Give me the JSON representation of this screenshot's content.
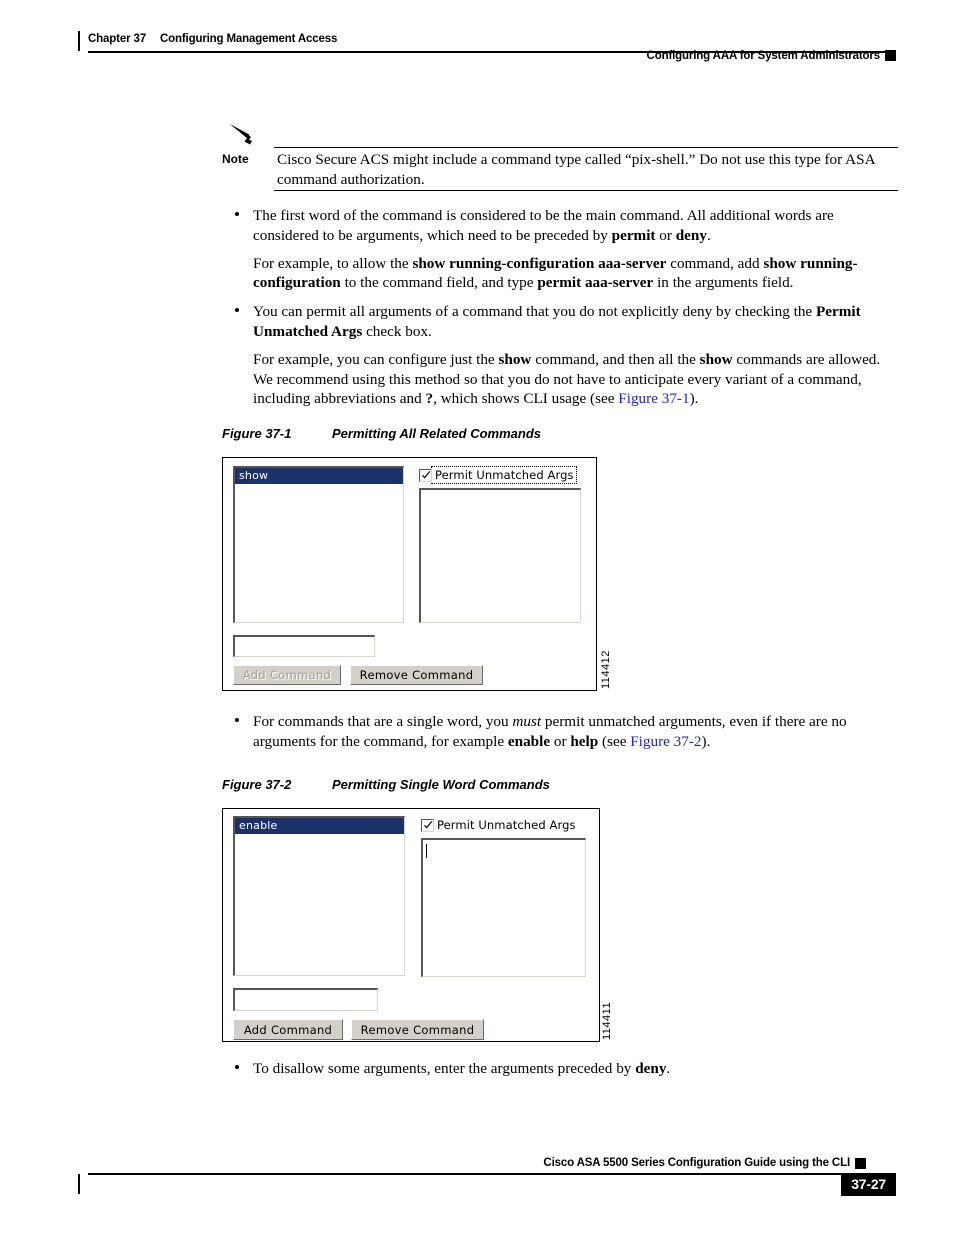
{
  "header": {
    "chapter_number": "Chapter 37",
    "chapter_title": "Configuring Management Access",
    "running_head": "Configuring AAA for System Administrators"
  },
  "note": {
    "label": "Note",
    "icon": "pencil-icon",
    "text": "Cisco Secure ACS might include a command type called “pix-shell.” Do not use this type for ASA command authorization."
  },
  "body": {
    "bullet1": {
      "seg1": "The first word of the command is considered to be the main command. All additional words are considered to be arguments, which need to be preceded by ",
      "bold1": "permit",
      "seg2": " or ",
      "bold2": "deny",
      "seg3": "."
    },
    "para1": {
      "seg1": "For example, to allow the ",
      "bold1": "show running-configuration aaa-server",
      "seg2": " command, add ",
      "bold2": "show running-configuration",
      "seg3": " to the command field, and type ",
      "bold3": "permit aaa-server",
      "seg4": " in the arguments field."
    },
    "bullet2": {
      "seg1": "You can permit all arguments of a command that you do not explicitly deny by checking the ",
      "bold1": "Permit Unmatched Args",
      "seg2": " check box."
    },
    "para2": {
      "seg1": "For example, you can configure just the ",
      "bold1": "show",
      "seg2": " command, and then all the ",
      "bold2": "show",
      "seg3": " commands are allowed. We recommend using this method so that you do not have to anticipate every variant of a command, including abbreviations and ",
      "bold3": "?",
      "seg4": ", which shows CLI usage (see ",
      "link1": "Figure 37-1",
      "seg5": ")."
    },
    "bullet3": {
      "seg1": "For commands that are a single word, you ",
      "italic1": "must",
      "seg2": " permit unmatched arguments, even if there are no arguments for the command, for example ",
      "bold1": "enable",
      "seg3": " or ",
      "bold2": "help",
      "seg4": " (see ",
      "link1": "Figure 37-2",
      "seg5": ")."
    },
    "bullet4": {
      "seg1": "To disallow some arguments, enter the arguments preceded by ",
      "bold1": "deny",
      "seg2": "."
    }
  },
  "figure1": {
    "caption_number": "Figure 37-1",
    "caption_title": "Permitting All Related Commands",
    "figure_id": "114412",
    "command_list_selected": "show",
    "checkbox_label": "Permit Unmatched Args",
    "checkbox_checked": true,
    "checkbox_focused": true,
    "command_input_value": "",
    "args_textarea_value": "",
    "add_button_label": "Add Command",
    "add_button_enabled": false,
    "remove_button_label": "Remove Command",
    "remove_button_enabled": true
  },
  "figure2": {
    "caption_number": "Figure 37-2",
    "caption_title": "Permitting Single Word Commands",
    "figure_id": "114411",
    "command_list_selected": "enable",
    "checkbox_label": "Permit Unmatched Args",
    "checkbox_checked": true,
    "checkbox_focused": false,
    "command_input_value": "",
    "args_textarea_value": "",
    "add_button_label": "Add Command",
    "add_button_enabled": true,
    "remove_button_label": "Remove Command",
    "remove_button_enabled": true
  },
  "footer": {
    "guide_title": "Cisco ASA 5500 Series Configuration Guide using the CLI",
    "page_number": "37-27"
  },
  "colors": {
    "link": "#2222cc",
    "selection": "#1b3168",
    "button_face": "#d4d0c8",
    "ink": "#000000"
  }
}
